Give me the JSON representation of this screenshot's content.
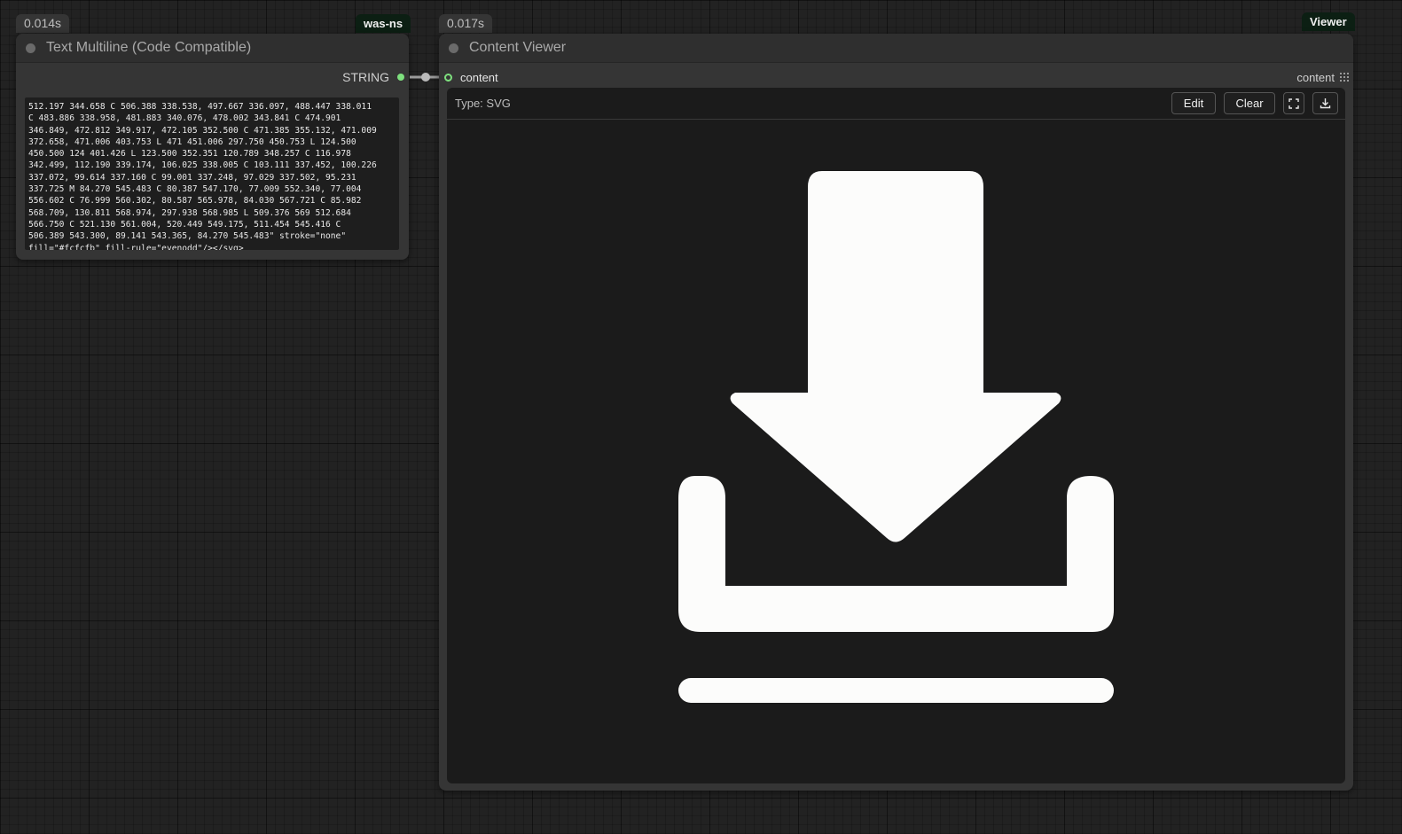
{
  "text_node": {
    "timing": "0.014s",
    "source": "was-ns",
    "title": "Text Multiline (Code Compatible)",
    "output_label": "STRING",
    "text_value": "512.197 344.658 C 506.388 338.538, 497.667 336.097, 488.447 338.011\nC 483.886 338.958, 481.883 340.076, 478.002 343.841 C 474.901\n346.849, 472.812 349.917, 472.105 352.500 C 471.385 355.132, 471.009\n372.658, 471.006 403.753 L 471 451.006 297.750 450.753 L 124.500\n450.500 124 401.426 L 123.500 352.351 120.789 348.257 C 116.978\n342.499, 112.190 339.174, 106.025 338.005 C 103.111 337.452, 100.226\n337.072, 99.614 337.160 C 99.001 337.248, 97.029 337.502, 95.231\n337.725 M 84.270 545.483 C 80.387 547.170, 77.009 552.340, 77.004\n556.602 C 76.999 560.302, 80.587 565.978, 84.030 567.721 C 85.982\n568.709, 130.811 568.974, 297.938 568.985 L 509.376 569 512.684\n566.750 C 521.130 561.004, 520.449 549.175, 511.454 545.416 C\n506.389 543.300, 89.141 543.365, 84.270 545.483\" stroke=\"none\"\nfill=\"#fcfcfb\" fill-rule=\"evenodd\"/></svg>"
  },
  "viewer_node": {
    "timing": "0.017s",
    "source": "Viewer",
    "title": "Content Viewer",
    "input_label": "content",
    "widget_label": "content",
    "type_label": "Type: SVG",
    "edit_label": "Edit",
    "clear_label": "Clear",
    "fullscreen_icon": "fullscreen-icon",
    "download_icon": "download-icon",
    "preview_icon": "download-tray-icon",
    "preview_fill": "#fcfcfb"
  },
  "colors": {
    "slot_green": "#7ee07e",
    "source_badge_bg": "#0c1f13"
  }
}
